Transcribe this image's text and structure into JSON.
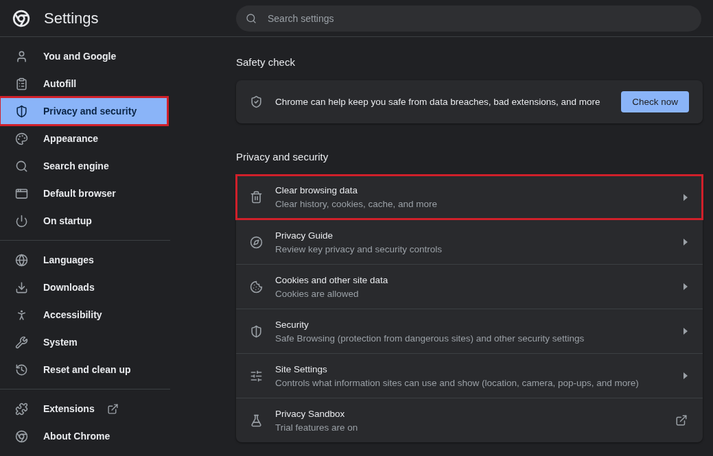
{
  "header": {
    "title": "Settings"
  },
  "search": {
    "placeholder": "Search settings"
  },
  "sidebar": {
    "groups": [
      {
        "items": [
          {
            "label": "You and Google",
            "selected": false,
            "highlighted": false,
            "external": false
          },
          {
            "label": "Autofill",
            "selected": false,
            "highlighted": false,
            "external": false
          },
          {
            "label": "Privacy and security",
            "selected": true,
            "highlighted": true,
            "external": false
          },
          {
            "label": "Appearance",
            "selected": false,
            "highlighted": false,
            "external": false
          },
          {
            "label": "Search engine",
            "selected": false,
            "highlighted": false,
            "external": false
          },
          {
            "label": "Default browser",
            "selected": false,
            "highlighted": false,
            "external": false
          },
          {
            "label": "On startup",
            "selected": false,
            "highlighted": false,
            "external": false
          }
        ]
      },
      {
        "items": [
          {
            "label": "Languages",
            "selected": false,
            "highlighted": false,
            "external": false
          },
          {
            "label": "Downloads",
            "selected": false,
            "highlighted": false,
            "external": false
          },
          {
            "label": "Accessibility",
            "selected": false,
            "highlighted": false,
            "external": false
          },
          {
            "label": "System",
            "selected": false,
            "highlighted": false,
            "external": false
          },
          {
            "label": "Reset and clean up",
            "selected": false,
            "highlighted": false,
            "external": false
          }
        ]
      },
      {
        "items": [
          {
            "label": "Extensions",
            "selected": false,
            "highlighted": false,
            "external": true
          },
          {
            "label": "About Chrome",
            "selected": false,
            "highlighted": false,
            "external": false
          }
        ]
      }
    ]
  },
  "safety_check": {
    "heading": "Safety check",
    "text": "Chrome can help keep you safe from data breaches, bad extensions, and more",
    "button": "Check now"
  },
  "privacy": {
    "heading": "Privacy and security",
    "rows": [
      {
        "title": "Clear browsing data",
        "subtitle": "Clear history, cookies, cache, and more",
        "kind": "subpage",
        "highlighted": true
      },
      {
        "title": "Privacy Guide",
        "subtitle": "Review key privacy and security controls",
        "kind": "subpage",
        "highlighted": false
      },
      {
        "title": "Cookies and other site data",
        "subtitle": "Cookies are allowed",
        "kind": "subpage",
        "highlighted": false
      },
      {
        "title": "Security",
        "subtitle": "Safe Browsing (protection from dangerous sites) and other security settings",
        "kind": "subpage",
        "highlighted": false
      },
      {
        "title": "Site Settings",
        "subtitle": "Controls what information sites can use and show (location, camera, pop-ups, and more)",
        "kind": "subpage",
        "highlighted": false
      },
      {
        "title": "Privacy Sandbox",
        "subtitle": "Trial features are on",
        "kind": "external",
        "highlighted": false
      }
    ]
  }
}
